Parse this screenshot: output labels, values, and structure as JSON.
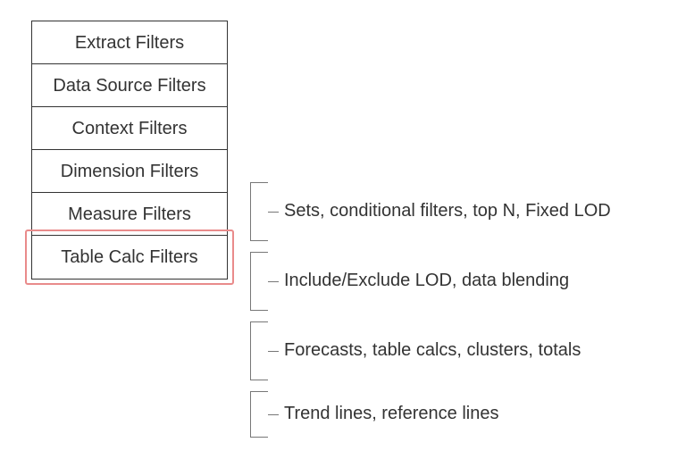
{
  "nodes": {
    "extract": "Extract Filters",
    "datasource": "Data Source Filters",
    "context": "Context Filters",
    "dimension": "Dimension Filters",
    "measure": "Measure Filters",
    "tablecalc": "Table Calc Filters"
  },
  "annotations": {
    "sets_fixed": "Sets, conditional filters, top N, Fixed LOD",
    "include_exclude": "Include/Exclude LOD, data blending",
    "forecasts": "Forecasts, table calcs, clusters, totals",
    "trend": "Trend lines, reference lines"
  }
}
